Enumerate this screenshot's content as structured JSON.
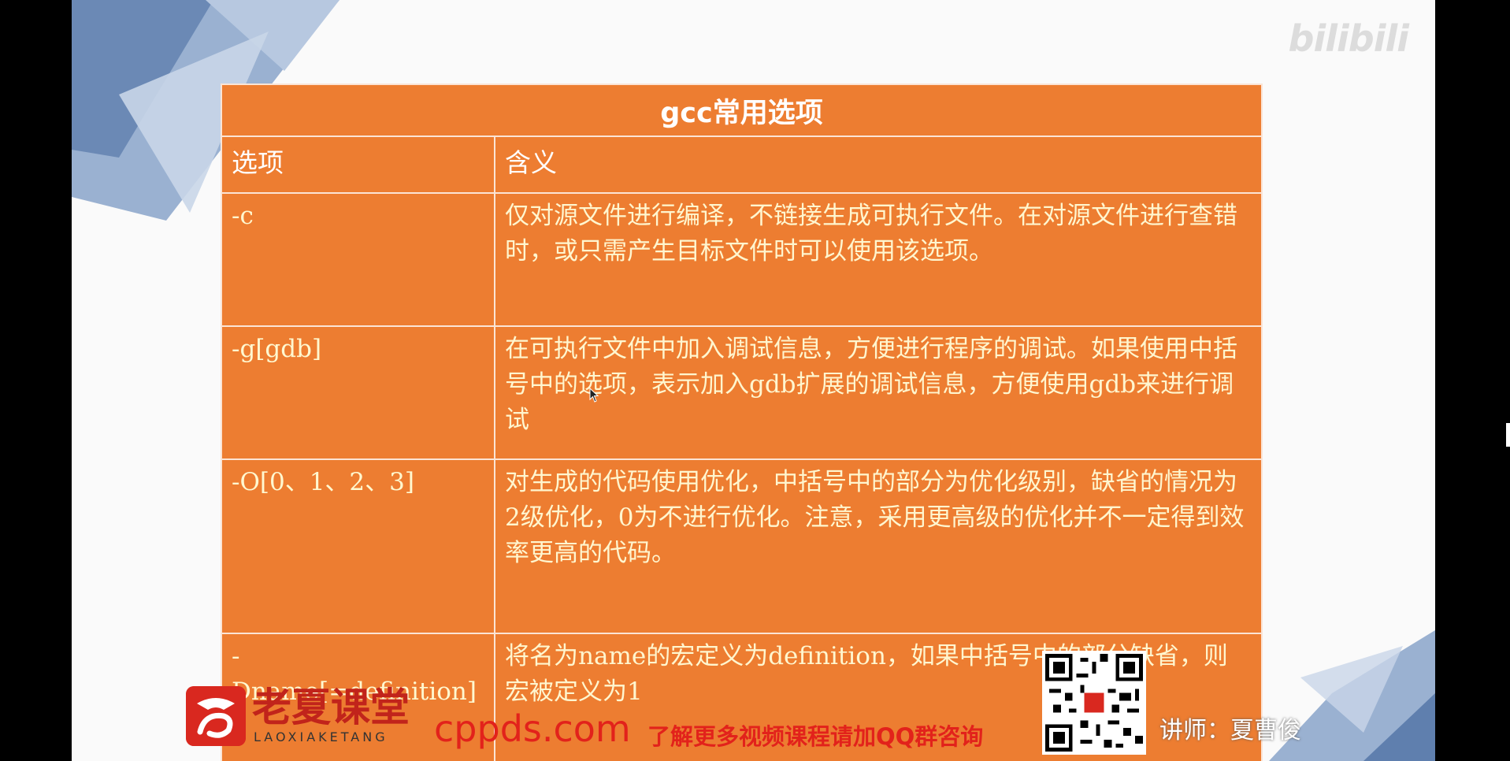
{
  "watermark": "bilibili",
  "table": {
    "title": "gcc常用选项",
    "headers": [
      "选项",
      "含义"
    ],
    "rows": [
      {
        "option": "-c",
        "meaning": "仅对源文件进行编译，不链接生成可执行文件。在对源文件进行查错时，或只需产生目标文件时可以使用该选项。"
      },
      {
        "option": "-g[gdb]",
        "meaning": "在可执行文件中加入调试信息，方便进行程序的调试。如果使用中括号中的选项，表示加入gdb扩展的调试信息，方便使用gdb来进行调试"
      },
      {
        "option": "-O[0、1、2、3]",
        "meaning": "对生成的代码使用优化，中括号中的部分为优化级别，缺省的情况为2级优化，0为不进行优化。注意，采用更高级的优化并不一定得到效率更高的代码。"
      },
      {
        "option": "-Dname[=definition]",
        "meaning": "将名为name的宏定义为definition，如果中括号中的部分缺省，则宏被定义为1"
      }
    ]
  },
  "brand": {
    "name": "老夏课堂",
    "pinyin": "LAOXIAKETANG",
    "site": "cppds.com",
    "promo": "了解更多视频课程请加QQ群咨询",
    "lecturer": "讲师：夏曹俊"
  },
  "colors": {
    "table_bg": "#ed7d31",
    "cell_border": "#fbe4d5",
    "deco_blue": "#8fa8cc",
    "brand_red": "#e2221b"
  }
}
